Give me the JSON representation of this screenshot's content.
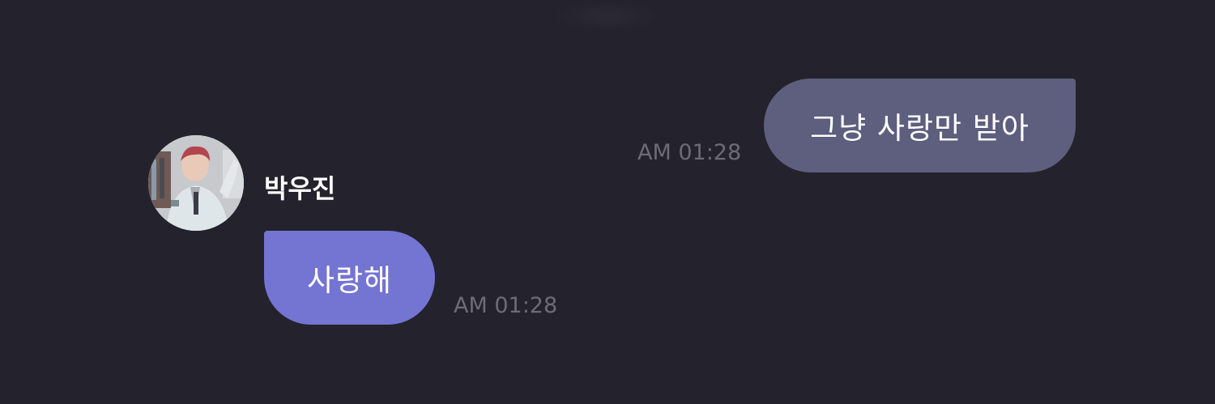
{
  "conversation": {
    "messages": [
      {
        "direction": "outgoing",
        "text": "그냥 사랑만 받아",
        "time": "AM 01:28",
        "bubble_color": "#5e5e7e"
      },
      {
        "direction": "incoming",
        "sender": "박우진",
        "avatar_icon": "profile-photo",
        "text": "사랑해",
        "time": "AM 01:28",
        "bubble_color": "#7474d3"
      }
    ]
  },
  "theme": {
    "background": "#24222c",
    "timestamp_color": "#6d6b78",
    "text_color": "#ffffff"
  }
}
